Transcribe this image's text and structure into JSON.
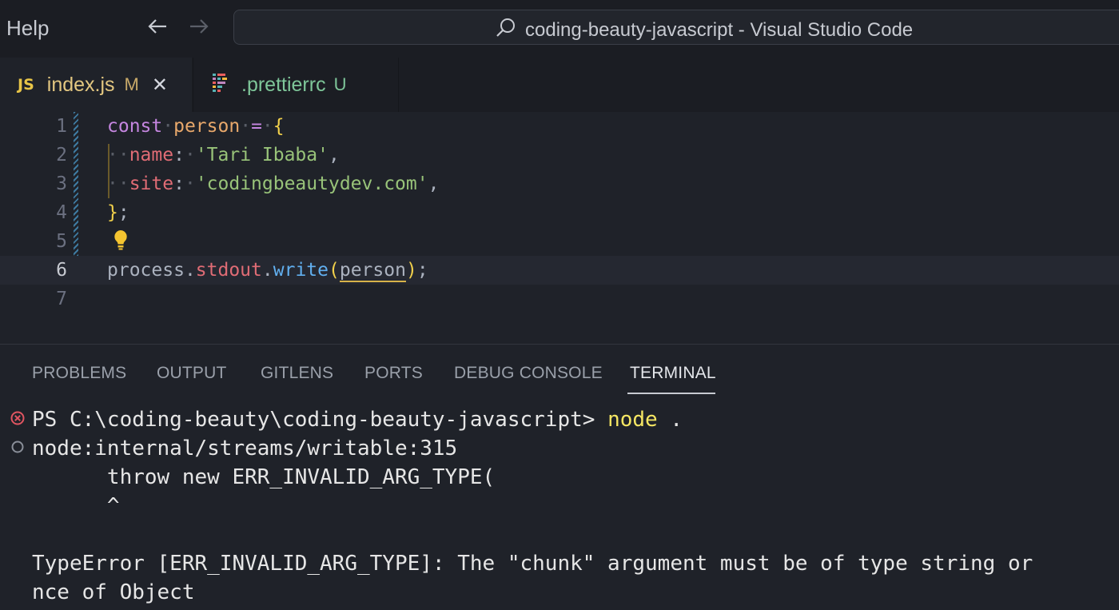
{
  "titlebar": {
    "menu_help": "Help",
    "title": "coding-beauty-javascript - Visual Studio Code",
    "icons": [
      "arrow-left-icon",
      "arrow-right-icon",
      "search-icon"
    ]
  },
  "tabs": [
    {
      "badge": "JS",
      "name": "index.js",
      "status": "M",
      "close": "✕",
      "active": true
    },
    {
      "name": ".prettierrc",
      "status": "U",
      "active": false
    }
  ],
  "editor": {
    "line_numbers": [
      "1",
      "2",
      "3",
      "4",
      "5",
      "6",
      "7"
    ],
    "current_line": 6,
    "code": {
      "l1": {
        "kw": "const",
        "var": "person",
        "op": "=",
        "brace": "{"
      },
      "l2": {
        "prop": "name",
        "colon": ":",
        "str": "'Tari Ibaba'",
        "comma": ","
      },
      "l3": {
        "prop": "site",
        "colon": ":",
        "str": "'codingbeautydev.com'",
        "comma": ","
      },
      "l4": {
        "brace": "}",
        "semi": ";"
      },
      "l6": {
        "obj": "process",
        "dot1": ".",
        "prop": "stdout",
        "dot2": ".",
        "fn": "write",
        "lp": "(",
        "arg": "person",
        "rp": ")",
        "semi": ";"
      }
    }
  },
  "panel": {
    "tabs": [
      "PROBLEMS",
      "OUTPUT",
      "GITLENS",
      "PORTS",
      "DEBUG CONSOLE",
      "TERMINAL"
    ],
    "active_tab": "TERMINAL",
    "terminal": {
      "prompt": "PS C:\\coding-beauty\\coding-beauty-javascript> ",
      "command": "node",
      "command_arg": " .",
      "lines": [
        "node:internal/streams/writable:315",
        "      throw new ERR_INVALID_ARG_TYPE(",
        "      ^",
        "",
        "TypeError [ERR_INVALID_ARG_TYPE]: The \"chunk\" argument must be of type string or",
        "nce of Object"
      ]
    }
  },
  "colors": {
    "background": "#1f2229",
    "keyword": "#c586e0",
    "string": "#98c379",
    "property": "#e06c75",
    "function": "#61afef",
    "terminal_command": "#f5e663",
    "error": "#e05561"
  }
}
